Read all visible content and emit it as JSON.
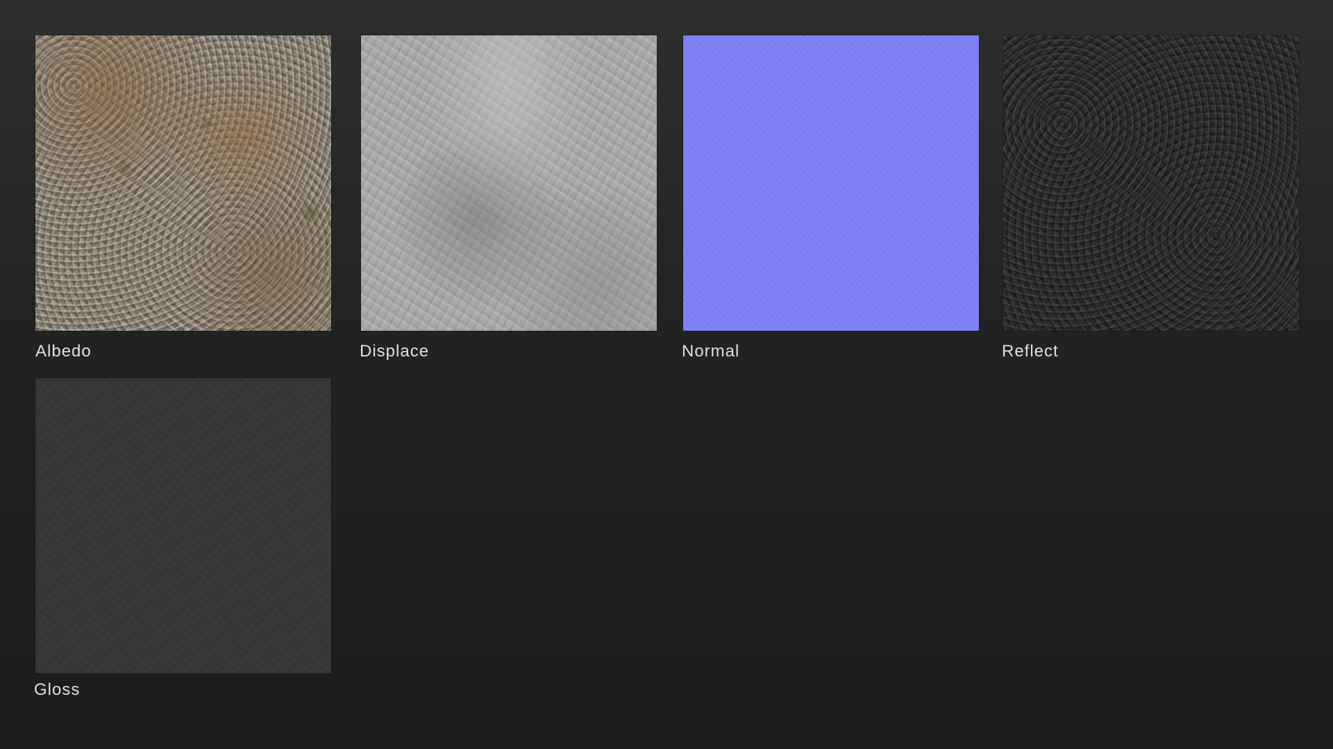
{
  "maps": [
    {
      "label": "Albedo",
      "preview": "albedo-texture",
      "dominant_color": "#8d8373"
    },
    {
      "label": "Displace",
      "preview": "displace-texture",
      "dominant_color": "#a9a9a9"
    },
    {
      "label": "Normal",
      "preview": "normal-texture",
      "dominant_color": "#8081f2"
    },
    {
      "label": "Reflect",
      "preview": "reflect-texture",
      "dominant_color": "#2f2f2f"
    },
    {
      "label": "Gloss",
      "preview": "gloss-texture",
      "dominant_color": "#373737"
    }
  ],
  "colors": {
    "background_top": "#2e2e2e",
    "background_bottom": "#1c1c1c",
    "label_text": "#e0e0e0"
  }
}
